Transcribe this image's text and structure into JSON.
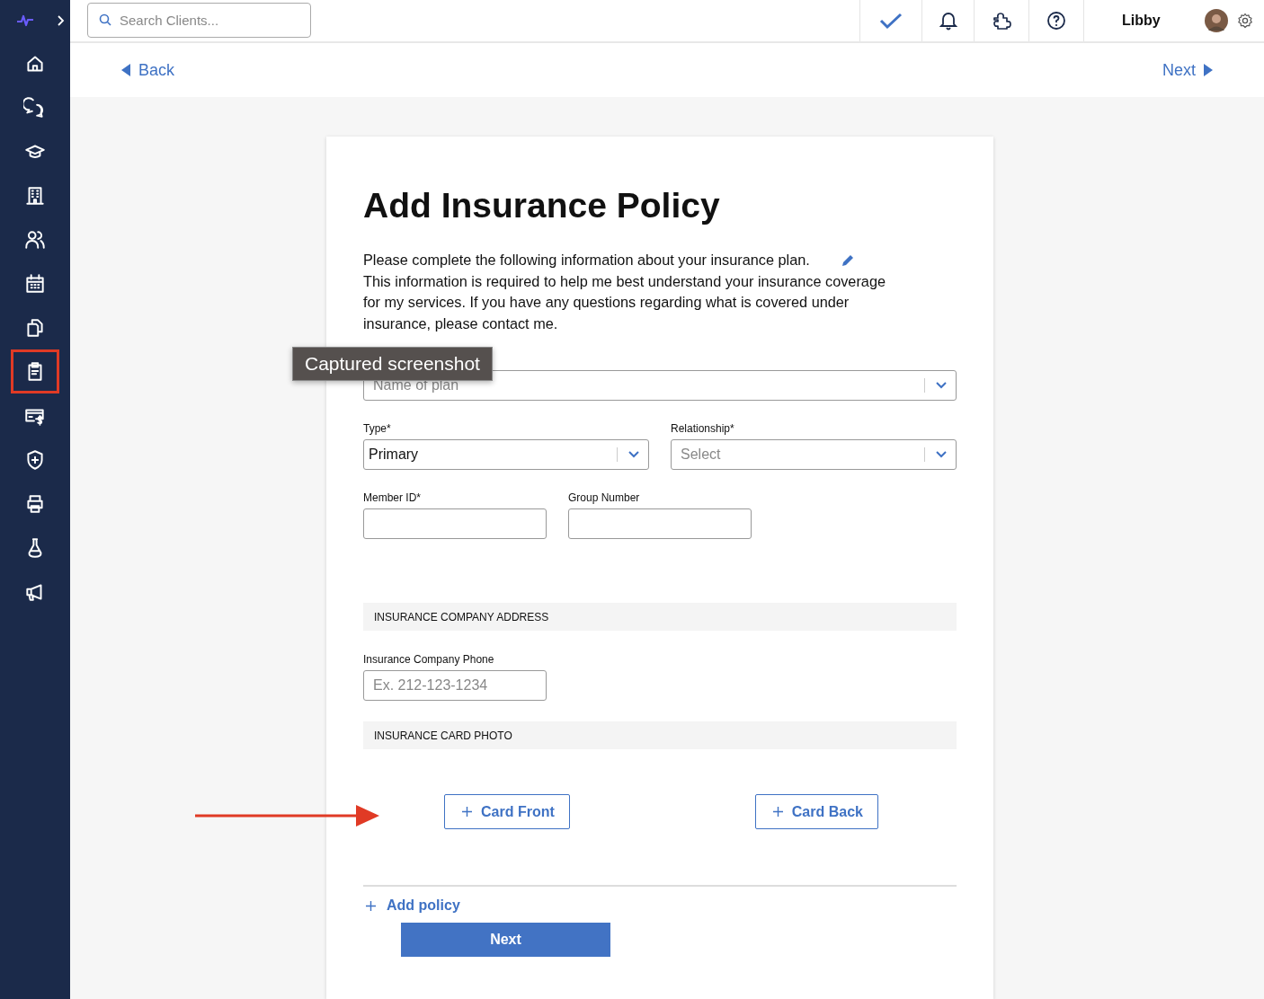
{
  "sidebar": {
    "items": [
      {
        "selected": false
      },
      {
        "selected": false
      },
      {
        "selected": false
      },
      {
        "selected": false
      },
      {
        "selected": false
      },
      {
        "selected": false
      },
      {
        "selected": false
      },
      {
        "selected": true
      },
      {
        "selected": false
      },
      {
        "selected": false
      },
      {
        "selected": false
      },
      {
        "selected": false
      },
      {
        "selected": false
      }
    ]
  },
  "topbar": {
    "search": {
      "placeholder": "Search Clients..."
    },
    "user": "Libby"
  },
  "nav": {
    "back": "Back",
    "next": "Next"
  },
  "form": {
    "title": "Add Insurance Policy",
    "description": [
      "Please complete the following information about your insurance plan.",
      "This information is required to help me best understand your insurance coverage for my services. If you have any questions regarding what is covered under insurance, please contact me."
    ],
    "plan": {
      "placeholder": "Name of plan"
    },
    "type": {
      "label": "Type*",
      "value": "Primary"
    },
    "relationship": {
      "label": "Relationship*",
      "placeholder": "Select"
    },
    "member_id": {
      "label": "Member ID*"
    },
    "group_number": {
      "label": "Group Number"
    },
    "sections": [
      "INSURANCE COMPANY ADDRESS",
      "INSURANCE CARD PHOTO"
    ],
    "phone": {
      "label": "Insurance Company Phone",
      "placeholder": "Ex. 212-123-1234"
    },
    "card_buttons": [
      "Card Front",
      "Card Back"
    ],
    "add_policy": "Add policy",
    "submit": "Next"
  },
  "tooltip": "Captured screenshot"
}
